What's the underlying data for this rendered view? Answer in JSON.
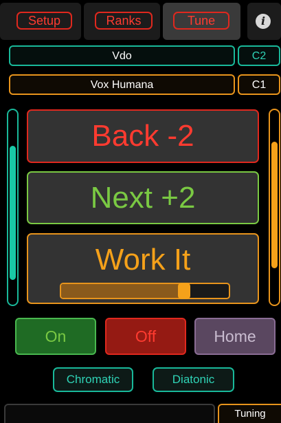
{
  "tabs": {
    "setup": "Setup",
    "ranks": "Ranks",
    "tune": "Tune"
  },
  "info_icon": "info-icon",
  "rank_upper": {
    "name": "Vdo",
    "label": "C2"
  },
  "rank_lower": {
    "name": "Vox Humana",
    "label": "C1"
  },
  "meters": {
    "left_level": 0.7,
    "right_level": 0.66
  },
  "controls": {
    "back": "Back  -2",
    "next": "Next  +2",
    "work": "Work It",
    "work_slider_level": 0.73
  },
  "buttons": {
    "on": "On",
    "off": "Off",
    "home": "Home"
  },
  "modes": {
    "chromatic": "Chromatic",
    "diatonic": "Diatonic"
  },
  "status": {
    "field_value": "",
    "tuning_label": "Tuning"
  },
  "colors": {
    "red": "#e0281e",
    "teal": "#19b99a",
    "orange": "#e8941c",
    "green": "#7ac943",
    "purple": "#8a6d95"
  }
}
